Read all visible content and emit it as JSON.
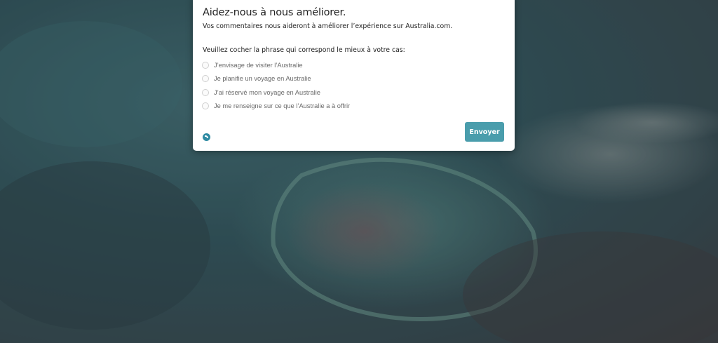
{
  "survey": {
    "title": "Aidez-nous à nous améliorer.",
    "subtitle": "Vos commentaires nous aideront à améliorer l’expérience sur Australia.com.",
    "question": "Veuillez cocher la phrase qui correspond le mieux à votre cas:",
    "options": [
      {
        "label": "J’envisage de visiter l’Australie"
      },
      {
        "label": "Je planifie un voyage en Australie"
      },
      {
        "label": "J’ai réservé mon voyage en Australie"
      },
      {
        "label": "Je me renseigne sur ce que l’Australie a à offrir"
      }
    ],
    "submit_label": "Envoyer",
    "brand_icon": "feedback-logo-icon"
  },
  "colors": {
    "accent": "#4a9dac",
    "background_water": "#3a5f66"
  }
}
